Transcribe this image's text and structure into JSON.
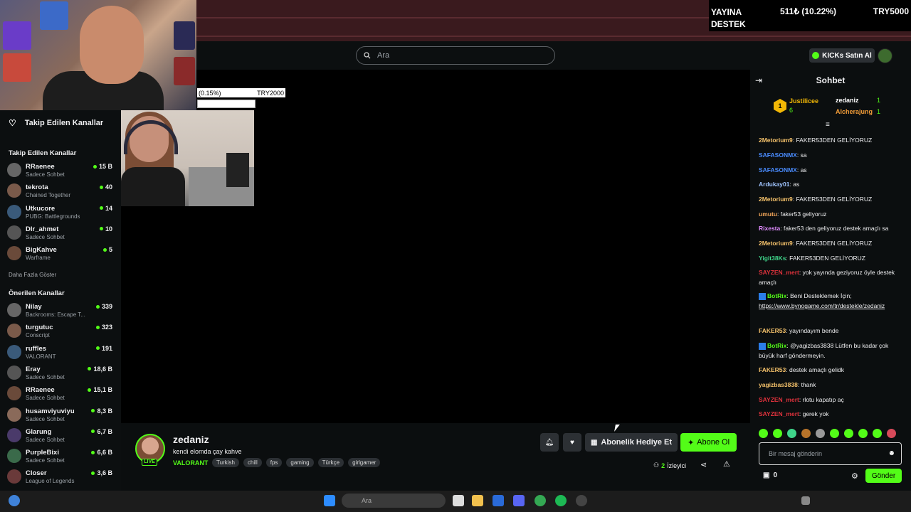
{
  "donation_overlay": {
    "label": "YAYINA DESTEK",
    "amount": "511₺ (10.22%)",
    "goal": "TRY5000"
  },
  "small_overlay": {
    "percent": "(0.15%)",
    "goal": "TRY2000"
  },
  "search": {
    "placeholder": "Ara"
  },
  "header": {
    "kicks_label": "KICKs Satın Al"
  },
  "sidebar": {
    "title": "Takip Edilen Kanallar",
    "followed_heading": "Takip Edilen Kanallar",
    "followed": [
      {
        "name": "RRaenee",
        "sub": "Sadece Sohbet",
        "viewers": "15 B"
      },
      {
        "name": "tekrota",
        "sub": "Chained Together",
        "viewers": "40"
      },
      {
        "name": "Utkucore",
        "sub": "PUBG: Battlegrounds",
        "viewers": "14"
      },
      {
        "name": "Dlr_ahmet",
        "sub": "Sadece Sohbet",
        "viewers": "10"
      },
      {
        "name": "BigKahve",
        "sub": "Warframe",
        "viewers": "5"
      }
    ],
    "show_more": "Daha Fazla Göster",
    "recommended_heading": "Önerilen Kanallar",
    "recommended": [
      {
        "name": "Nilay",
        "sub": "Backrooms: Escape T...",
        "viewers": "339"
      },
      {
        "name": "turgutuc",
        "sub": "Conscript",
        "viewers": "323"
      },
      {
        "name": "ruffles",
        "sub": "VALORANT",
        "viewers": "191"
      },
      {
        "name": "Eray",
        "sub": "Sadece Sohbet",
        "viewers": "18,6 B"
      },
      {
        "name": "RRaenee",
        "sub": "Sadece Sohbet",
        "viewers": "15,1 B"
      },
      {
        "name": "husamviyuviyu",
        "sub": "Sadece Sohbet",
        "viewers": "8,3 B"
      },
      {
        "name": "Glarung",
        "sub": "Sadece Sohbet",
        "viewers": "6,7 B"
      },
      {
        "name": "PurpleBixi",
        "sub": "Sadece Sohbet",
        "viewers": "6,6 B"
      },
      {
        "name": "Closer",
        "sub": "League of Legends",
        "viewers": "3,6 B"
      }
    ]
  },
  "stream": {
    "streamer": "zedaniz",
    "live_badge": "LIVE",
    "title": "kendi elomda çay kahve",
    "category": "VALORANT",
    "tags": [
      "Turkish",
      "chill",
      "fps",
      "gaming",
      "Türkçe",
      "girlgamer"
    ],
    "gift_label": "Abonelik Hediye Et",
    "subscribe_label": "Abone Ol",
    "viewer_count": "2",
    "viewer_label": "İzleyici"
  },
  "chat": {
    "title": "Sohbet",
    "top": [
      {
        "name": "Justilicee",
        "count": "6"
      },
      {
        "name": "zedaniz",
        "count": "1"
      },
      {
        "name": "Alcherajung",
        "count": "1"
      }
    ],
    "top_rank": "1",
    "messages": [
      {
        "user": "2Metorium9",
        "color": "#f5c26b",
        "text": "FAKER53DEN GELİYORUZ"
      },
      {
        "user": "SAFASONMX",
        "color": "#4a8cff",
        "text": "sa"
      },
      {
        "user": "SAFASONMX",
        "color": "#4a8cff",
        "text": "as"
      },
      {
        "user": "Ardukay01",
        "color": "#a0c4ff",
        "text": "as"
      },
      {
        "user": "2Metorium9",
        "color": "#f5c26b",
        "text": "FAKER53DEN GELİYORUZ"
      },
      {
        "user": "umutu",
        "color": "#f2a65a",
        "text": "faker53 geliyoruz"
      },
      {
        "user": "Rixesta",
        "color": "#e08cff",
        "text": "faker53 den geliyoruz destek amaçlı sa"
      },
      {
        "user": "2Metorium9",
        "color": "#f5c26b",
        "text": "FAKER53DEN GELİYORUZ"
      },
      {
        "user": "Yigit38Ks",
        "color": "#3fd48a",
        "text": "FAKER53DEN GELİYORUZ"
      },
      {
        "user": "SAYZEN_mert",
        "color": "#e0323c",
        "text": "yok yayında geziyoruz öyle destek amaçlı"
      },
      {
        "user": "BotRix",
        "color": "#53fc18",
        "text": "Beni Desteklemek İçin;",
        "link": "https://www.bynogame.com/tr/destekle/zedaniz"
      },
      {
        "user": "FAKER53",
        "color": "#f5c26b",
        "text": "yayındayım bende"
      },
      {
        "user": "BotRix",
        "color": "#53fc18",
        "text": "@yagizbas3838 Lütfen bu kadar çok büyük harf göndermeyin."
      },
      {
        "user": "FAKER53",
        "color": "#f5c26b",
        "text": "destek amaçlı gelidk"
      },
      {
        "user": "yagizbas3838",
        "color": "#f5c26b",
        "text": "thank"
      },
      {
        "user": "SAYZEN_mert",
        "color": "#e0323c",
        "text": "rlotu kapatıp aç"
      },
      {
        "user": "SAYZEN_mert",
        "color": "#e0323c",
        "text": "gerek yok"
      }
    ],
    "input_placeholder": "Bir mesaj gönderin",
    "points": "0",
    "send_label": "Gönder"
  },
  "taskbar": {
    "search_placeholder": "Ara"
  },
  "colors": {
    "accent": "#53fc18",
    "background": "#0b0e0f"
  }
}
